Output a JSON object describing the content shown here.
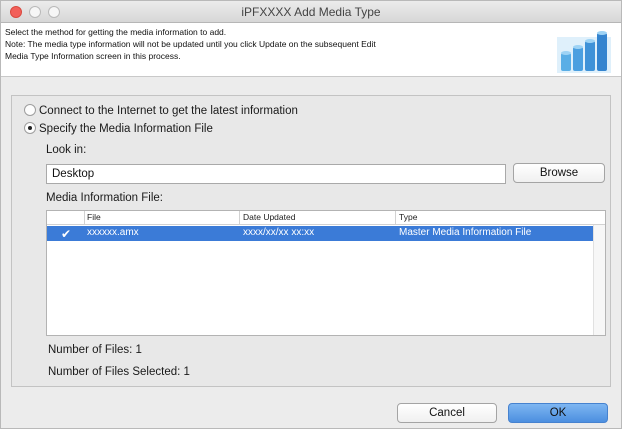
{
  "window": {
    "title": "iPFXXXX Add Media Type"
  },
  "header": {
    "line1": "Select the method for getting the media information to add.",
    "line2": "Note: The media type information will not be updated until you click Update on the subsequent Edit",
    "line3": "Media Type Information screen in this process."
  },
  "options": {
    "internet_label": "Connect to the Internet to get the latest information",
    "file_label": "Specify the Media Information File"
  },
  "look_in": {
    "label": "Look in:",
    "value": "Desktop",
    "browse_label": "Browse"
  },
  "media_file": {
    "label": "Media Information File:",
    "columns": [
      "File",
      "Date Updated",
      "Type"
    ],
    "rows": [
      {
        "checked": true,
        "file": "xxxxxx.amx",
        "date": "xxxx/xx/xx xx:xx",
        "type": "Master Media Information File"
      }
    ]
  },
  "counts": {
    "files": "Number of Files: 1",
    "selected": "Number of Files Selected: 1"
  },
  "footer": {
    "cancel_label": "Cancel",
    "ok_label": "OK"
  },
  "colors": {
    "selection": "#3b7bd7",
    "ok_button": "#5f9fe6",
    "close_button": "#f2605a"
  },
  "icons": [
    "close-icon",
    "minimize-icon",
    "zoom-icon",
    "media-rolls-icon",
    "radio-icon",
    "checkmark-icon"
  ]
}
